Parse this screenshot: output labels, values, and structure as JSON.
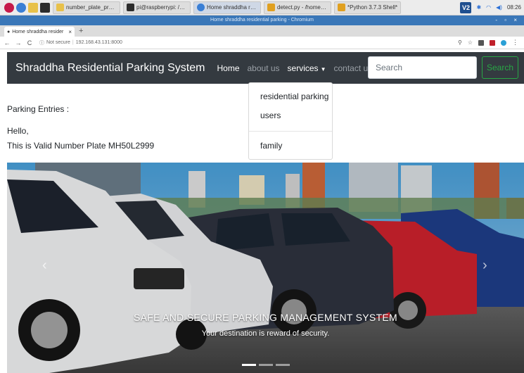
{
  "taskbar": {
    "tasks": [
      {
        "label": "number_plate_project",
        "color": "#e8c14a"
      },
      {
        "label": "pi@raspberrypi: /var/...",
        "color": "#2c2c2c"
      },
      {
        "label": "Home shraddha resid...",
        "color": "#3a7fd5"
      },
      {
        "label": "detect.py - /home/pi/...",
        "color": "#e0a020"
      },
      {
        "label": "*Python 3.7.3 Shell*",
        "color": "#e0a020"
      }
    ],
    "tray_vnc": "V2",
    "clock": "08:26"
  },
  "browser": {
    "window_title": "Home shraddha residential parking - Chromium",
    "window_controls": "- ▫ ×",
    "tab_title": "Home shraddha resider",
    "tab_close": "×",
    "new_tab": "+",
    "security_label": "Not secure",
    "url": "192.168.43.131:8000"
  },
  "navbar": {
    "brand": "Shraddha Residential Parking System",
    "links": [
      "Home",
      "about us",
      "services",
      "contact us"
    ],
    "search_placeholder": "Search",
    "search_button": "Search"
  },
  "dropdown": {
    "items": [
      "residential parking",
      "users",
      "family"
    ]
  },
  "content": {
    "entries_heading": "Parking Entries :",
    "greeting": "Hello,",
    "message": "This is Valid Number Plate MH50L2999"
  },
  "carousel": {
    "title": "SAFE AND SECURE PARKING MANAGEMENT SYSTEM",
    "subtitle": "Your destination is reward of security.",
    "prev": "‹",
    "next": "›"
  },
  "colors": {
    "navbar_bg": "#343a40",
    "search_button_border": "#28a745",
    "browser_titlebar": "#3a77b8"
  }
}
